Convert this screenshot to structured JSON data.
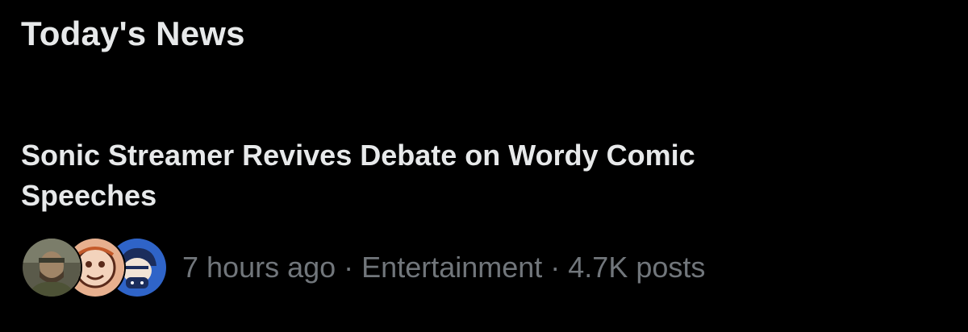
{
  "section": {
    "title": "Today's News"
  },
  "story": {
    "headline": "Sonic Streamer Revives Debate on Wordy Comic Speeches",
    "time_ago": "7 hours ago",
    "category": "Entertainment",
    "post_count": "4.7K posts",
    "separator": "·",
    "avatars": [
      {
        "icon": "soldier-portrait-avatar"
      },
      {
        "icon": "cartoon-face-avatar"
      },
      {
        "icon": "gamer-controller-avatar"
      }
    ]
  },
  "colors": {
    "background": "#000000",
    "primary_text": "#e7e9ea",
    "secondary_text": "#71767b"
  }
}
